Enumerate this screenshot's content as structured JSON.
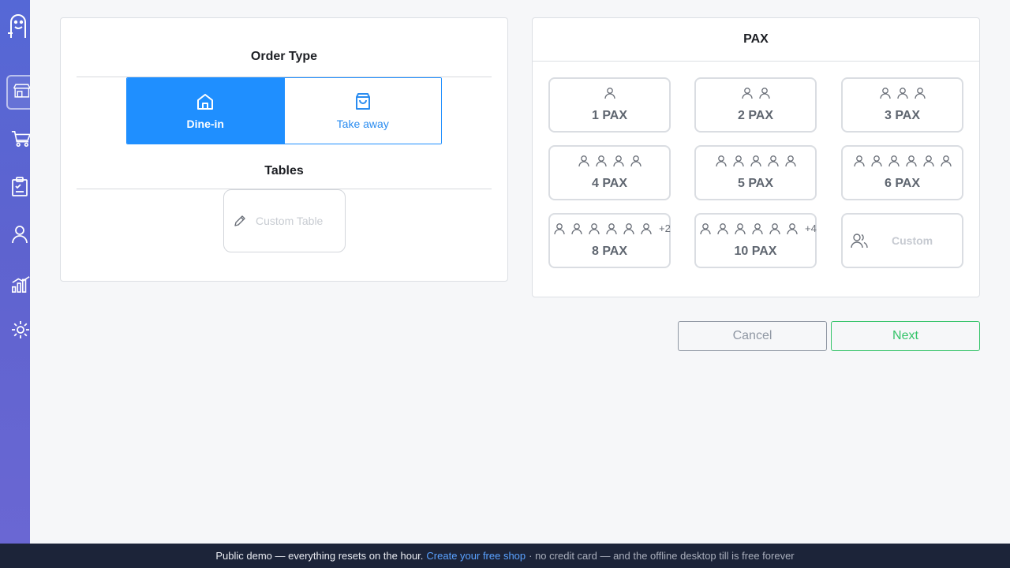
{
  "sidebar": {
    "items": [
      {
        "name": "logo",
        "icon": "ghost-logo-icon"
      },
      {
        "name": "store",
        "icon": "store-icon",
        "active": true
      },
      {
        "name": "cart",
        "icon": "cart-icon"
      },
      {
        "name": "orders",
        "icon": "clipboard-icon"
      },
      {
        "name": "customers",
        "icon": "user-icon"
      },
      {
        "name": "reports",
        "icon": "bar-chart-icon"
      },
      {
        "name": "settings",
        "icon": "gear-icon"
      }
    ]
  },
  "order_type": {
    "title": "Order Type",
    "options": [
      {
        "label": "Dine-in",
        "icon": "home-icon",
        "active": true
      },
      {
        "label": "Take away",
        "icon": "shopping-bag-icon",
        "active": false
      }
    ]
  },
  "tables": {
    "title": "Tables",
    "custom_placeholder": "Custom Table"
  },
  "pax": {
    "title": "PAX",
    "options": [
      {
        "label": "1 PAX",
        "persons": 1,
        "extra": ""
      },
      {
        "label": "2 PAX",
        "persons": 2,
        "extra": ""
      },
      {
        "label": "3 PAX",
        "persons": 3,
        "extra": ""
      },
      {
        "label": "4 PAX",
        "persons": 4,
        "extra": ""
      },
      {
        "label": "5 PAX",
        "persons": 5,
        "extra": ""
      },
      {
        "label": "6 PAX",
        "persons": 6,
        "extra": ""
      },
      {
        "label": "8 PAX",
        "persons": 6,
        "extra": "+2"
      },
      {
        "label": "10 PAX",
        "persons": 6,
        "extra": "+4"
      }
    ],
    "custom_placeholder": "Custom"
  },
  "actions": {
    "cancel": "Cancel",
    "next": "Next"
  },
  "footer": {
    "text": "Public demo — everything resets on the hour.",
    "link": "Create your free shop",
    "rest": "· no credit card — and the offline desktop till is free forever"
  },
  "colors": {
    "accent": "#1f8fff",
    "next": "#34c369",
    "sidebar": "#5e63cf",
    "footer": "#1c2439"
  }
}
